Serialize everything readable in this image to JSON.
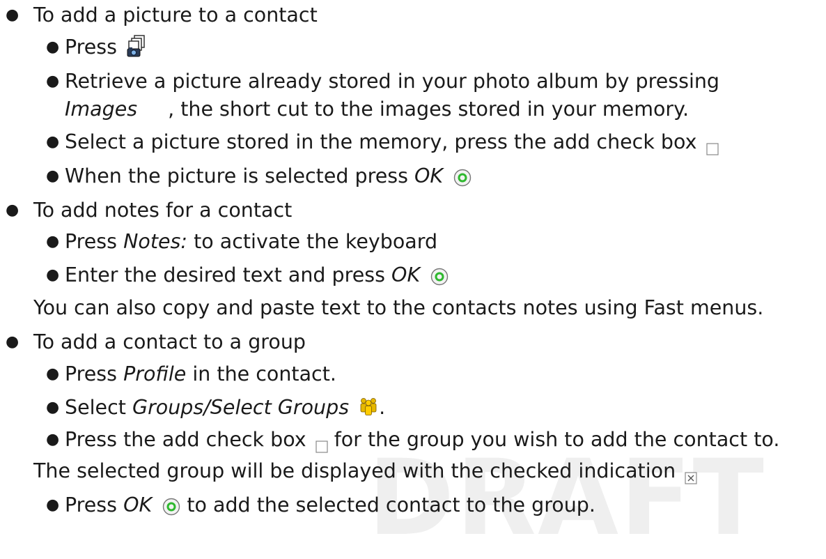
{
  "watermark": "DRAFT",
  "items": {
    "add_picture": "To add a picture to a contact",
    "press": "Press",
    "retrieve_1": "Retrieve a picture already stored in your photo album by pressing",
    "images": "Images",
    "retrieve_2": ", the short cut to the images stored in your memory.",
    "select_picture": "Select a picture stored in the memory, press the add check box",
    "when_selected": "When the picture is selected press",
    "ok": "OK",
    "add_notes": "To add notes for a contact",
    "press_notes": "Press",
    "notes": "Notes:",
    "activate_keyboard": "to activate the keyboard",
    "enter_text": "Enter the desired text and press",
    "copy_paste": "You can also copy and paste text to the contacts notes using Fast menus.",
    "add_group": "To add a contact to a group",
    "profile": "Profile",
    "in_contact": "in the contact.",
    "select": "Select",
    "groups": "Groups/Select Groups",
    "period": ".",
    "press_check": "Press the add check box",
    "for_group": "for the group you wish to add the contact to.",
    "selected_group": "The selected group will be displayed with the checked indication",
    "to_add_selected": "to add the selected contact to the group."
  },
  "icons": {
    "camera": "camera-icon",
    "ok_button": "ok-button-icon",
    "checkbox_empty": "checkbox-empty-icon",
    "checkbox_checked": "checkbox-checked-icon",
    "groups": "group-people-icon"
  },
  "colors": {
    "text": "#1a1a1a",
    "watermark": "#efefef",
    "ok_green": "#2eb82e",
    "group_yellow": "#e6b800"
  }
}
